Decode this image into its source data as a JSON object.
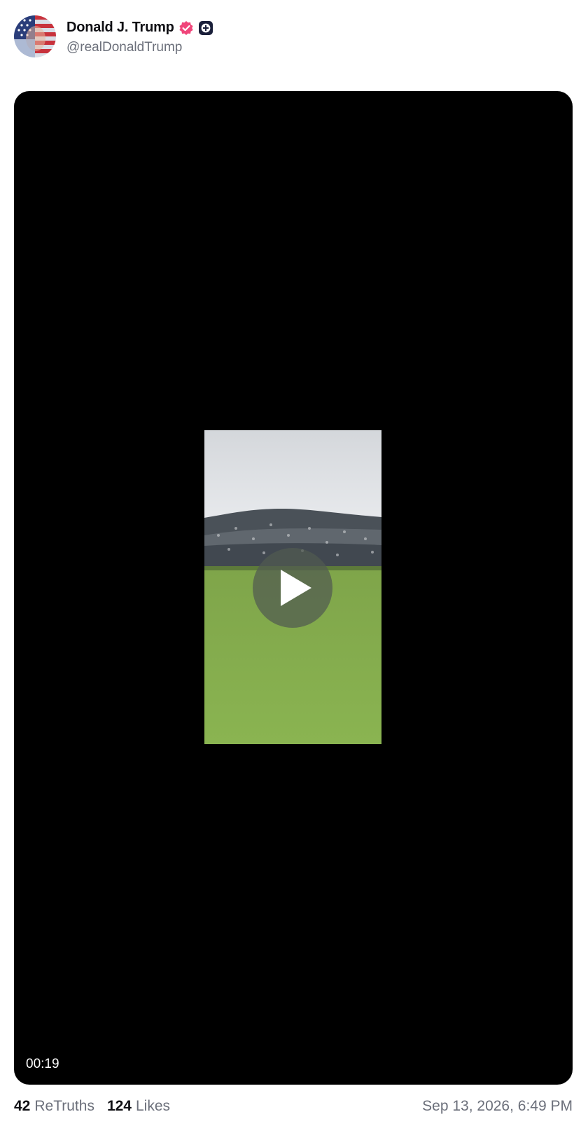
{
  "author": {
    "display_name": "Donald J. Trump",
    "handle": "@realDonaldTrump",
    "avatar_icon": "flag-portrait-avatar",
    "verified_icon": "verified-badge-icon",
    "verified_color": "#f0457a",
    "plus_badge_icon": "plus-badge-icon"
  },
  "media": {
    "type": "video",
    "duration": "00:19",
    "play_icon": "play-icon"
  },
  "stats": {
    "retruths_count": "42",
    "retruths_label": "ReTruths",
    "likes_count": "124",
    "likes_label": "Likes"
  },
  "timestamp": "Sep 13, 2026, 6:49 PM"
}
